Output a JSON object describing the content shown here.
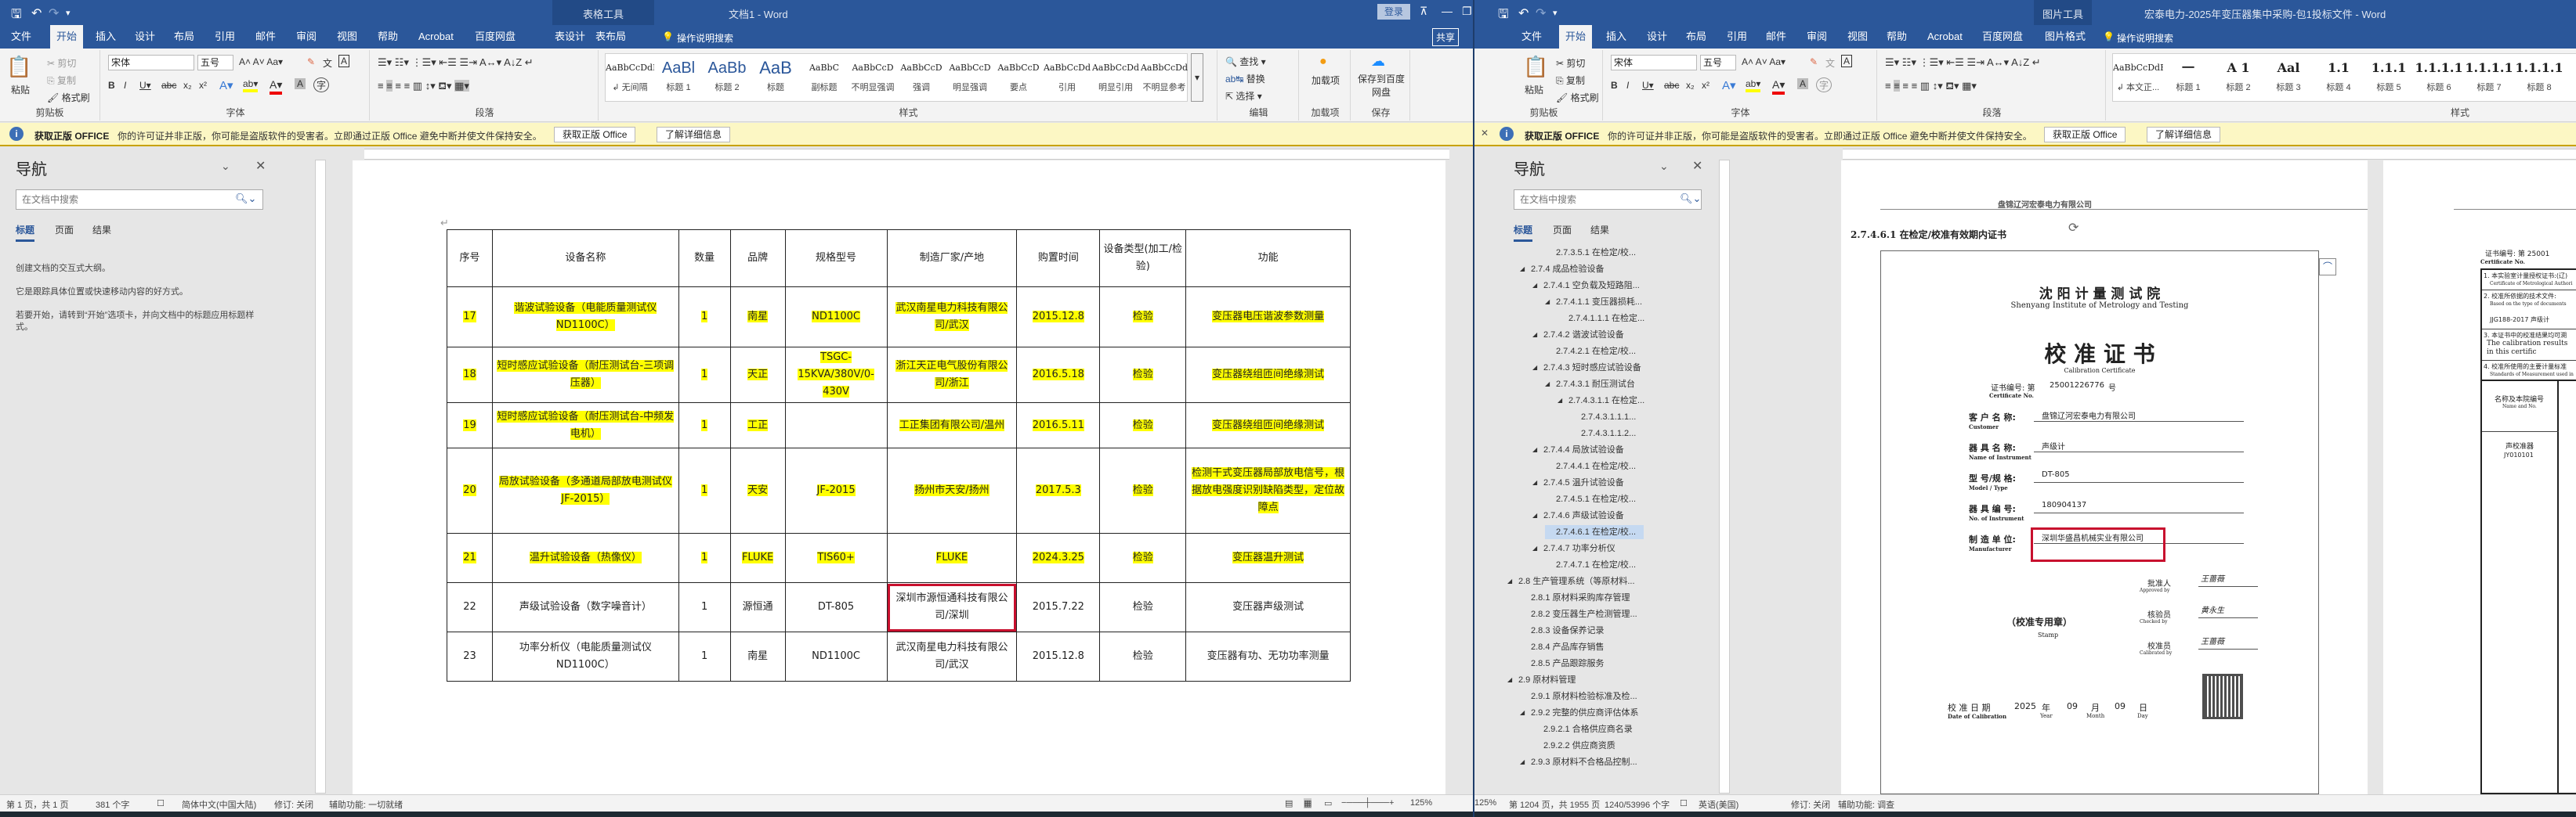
{
  "left": {
    "title": "文档1  -  Word",
    "context_group": "表格工具",
    "login": "登录",
    "share": "共享",
    "tabs": [
      "文件",
      "开始",
      "插入",
      "设计",
      "布局",
      "引用",
      "邮件",
      "审阅",
      "视图",
      "帮助",
      "Acrobat",
      "百度网盘",
      "表设计",
      "表布局"
    ],
    "tell_me": "操作说明搜索",
    "ribbon": {
      "paste": "粘贴",
      "cut": "剪切",
      "copy": "复制",
      "format_painter": "格式刷",
      "font_name": "宋体",
      "font_size": "五号",
      "group_clipboard": "剪贴板",
      "group_font": "字体",
      "group_paragraph": "段落",
      "group_styles": "样式",
      "group_editing": "编辑",
      "group_addins": "加载项",
      "group_save": "保存",
      "find": "查找",
      "replace": "替换",
      "select": "选择",
      "addins": "加载项",
      "save_baidu": "保存到百度网盘",
      "styles": [
        {
          "preview": "AaBbCcDdE",
          "name": "↲ 无间隔"
        },
        {
          "preview": "AaBl",
          "name": "标题 1"
        },
        {
          "preview": "AaBb",
          "name": "标题 2"
        },
        {
          "preview": "AaB",
          "name": "标题"
        },
        {
          "preview": "AaBbC",
          "name": "副标题"
        },
        {
          "preview": "AaBbCcD",
          "name": "不明显强调"
        },
        {
          "preview": "AaBbCcD",
          "name": "强调"
        },
        {
          "preview": "AaBbCcD",
          "name": "明显强调"
        },
        {
          "preview": "AaBbCcD",
          "name": "要点"
        },
        {
          "preview": "AaBbCcDd",
          "name": "引用"
        },
        {
          "preview": "AaBbCcDd",
          "name": "明显引用"
        },
        {
          "preview": "AaBbCcDd",
          "name": "不明显参考"
        }
      ]
    },
    "infobar": {
      "title": "获取正版 OFFICE",
      "message": "你的许可证并非正版，你可能是盗版软件的受害者。立即通过正版 Office 避免中断并使文件保持安全。",
      "get_button": "获取正版 Office",
      "learn_button": "了解详细信息"
    },
    "nav": {
      "title": "导航",
      "search_placeholder": "在文档中搜索",
      "tabs": [
        "标题",
        "页面",
        "结果"
      ],
      "hints": [
        "创建文档的交互式大纲。",
        "它是跟踪具体位置或快速移动内容的好方式。",
        "若要开始，请转到“开始”选项卡，并向文档中的标题应用标题样式。"
      ]
    },
    "table": {
      "headers": [
        "序号",
        "设备名称",
        "数量",
        "品牌",
        "规格型号",
        "制造厂家/产地",
        "购置时间",
        "设备类型(加工/检验)",
        "功能"
      ],
      "rows": [
        {
          "highlight": true,
          "cells": [
            "17",
            "谐波试验设备（电能质量测试仪ND1100C）",
            "1",
            "南星",
            "ND1100C",
            "武汉南星电力科技有限公司/武汉",
            "2015.12.8",
            "检验",
            "变压器电压谐波参数测量"
          ]
        },
        {
          "highlight": true,
          "cells": [
            "18",
            "短时感应试验设备（耐压测试台-三项调压器）",
            "1",
            "天正",
            "TSGC-15KVA/380V/0-430V",
            "浙江天正电气股份有限公司/浙江",
            "2016.5.18",
            "检验",
            "变压器绕组匝间绝缘测试"
          ]
        },
        {
          "highlight": true,
          "cells": [
            "19",
            "短时感应试验设备（耐压测试台-中频发电机）",
            "1",
            "工正",
            "",
            "工正集团有限公司/温州",
            "2016.5.11",
            "检验",
            "变压器绕组匝间绝缘测试"
          ]
        },
        {
          "highlight": true,
          "cells": [
            "20",
            "局放试验设备（多通道局部放电测试仪JF-2015）",
            "1",
            "天安",
            "JF-2015",
            "扬州市天安/扬州",
            "2017.5.3",
            "检验",
            "检测干式变压器局部放电信号，根据放电强度识别缺陷类型，定位故障点"
          ]
        },
        {
          "highlight": true,
          "cells": [
            "21",
            "温升试验设备（热像仪）",
            "1",
            "FLUKE",
            "TIS60+",
            "FLUKE",
            "2024.3.25",
            "检验",
            "变压器温升测试"
          ]
        },
        {
          "highlight": false,
          "boxed_col": 5,
          "cells": [
            "22",
            "声级试验设备（数字噪音计）",
            "1",
            "源恒通",
            "DT-805",
            "深圳市源恒通科技有限公司/深圳",
            "2015.7.22",
            "检验",
            "变压器声级测试"
          ]
        },
        {
          "highlight": false,
          "cells": [
            "23",
            "功率分析仪（电能质量测试仪ND1100C）",
            "1",
            "南星",
            "ND1100C",
            "武汉南星电力科技有限公司/武汉",
            "2015.12.8",
            "检验",
            "变压器有功、无功功率测量"
          ]
        }
      ]
    },
    "status": {
      "page": "第 1 页，共 1 页",
      "words": "381 个字",
      "language": "简体中文(中国大陆)",
      "track": "修订: 关闭",
      "accessibility": "辅助功能: 一切就绪",
      "zoom": "125%"
    }
  },
  "right": {
    "title": "宏泰电力-2025年变压器集中采购-包1投标文件  -  Word",
    "context_group": "图片工具",
    "tabs": [
      "文件",
      "开始",
      "插入",
      "设计",
      "布局",
      "引用",
      "邮件",
      "审阅",
      "视图",
      "帮助",
      "Acrobat",
      "百度网盘",
      "图片格式"
    ],
    "tell_me": "操作说明搜索",
    "ribbon": {
      "paste": "粘贴",
      "cut": "剪切",
      "copy": "复制",
      "format_painter": "格式刷",
      "font_name": "宋体",
      "font_size": "五号",
      "group_clipboard": "剪贴板",
      "group_font": "字体",
      "group_paragraph": "段落",
      "group_styles": "样式",
      "styles": [
        {
          "preview": "AaBbCcDdE",
          "name": "↲ 本文正..."
        },
        {
          "preview": "一",
          "name": "标题 1"
        },
        {
          "preview": "A 1",
          "name": "标题 2"
        },
        {
          "preview": "Aal",
          "name": "标题 3"
        },
        {
          "preview": "1.1",
          "name": "标题 4"
        },
        {
          "preview": "1.1.1",
          "name": "标题 5"
        },
        {
          "preview": "1.1.1.1",
          "name": "标题 6"
        },
        {
          "preview": "1.1.1.1",
          "name": "标题 7"
        },
        {
          "preview": "1.1.1.1",
          "name": "标题 8"
        }
      ]
    },
    "infobar": {
      "title": "获取正版 OFFICE",
      "message": "你的许可证并非正版，你可能是盗版软件的受害者。立即通过正版 Office 避免中断并使文件保持安全。",
      "get_button": "获取正版 Office",
      "learn_button": "了解详细信息"
    },
    "nav": {
      "title": "导航",
      "search_placeholder": "在文档中搜索",
      "tabs": [
        "标题",
        "页面",
        "结果"
      ],
      "items": [
        {
          "text": "2.7.3.5.1 在检定/校...",
          "level": 4,
          "arrow": false
        },
        {
          "text": "2.7.4 成品检验设备",
          "level": 2,
          "arrow": true
        },
        {
          "text": "2.7.4.1 空负载及短路阻...",
          "level": 3,
          "arrow": true
        },
        {
          "text": "2.7.4.1.1 变压器损耗...",
          "level": 4,
          "arrow": true
        },
        {
          "text": "2.7.4.1.1.1 在检定...",
          "level": 5,
          "arrow": false
        },
        {
          "text": "2.7.4.2 谐波试验设备",
          "level": 3,
          "arrow": true
        },
        {
          "text": "2.7.4.2.1 在检定/校...",
          "level": 4,
          "arrow": false
        },
        {
          "text": "2.7.4.3 短时感应试验设备",
          "level": 3,
          "arrow": true
        },
        {
          "text": "2.7.4.3.1 耐压测试台",
          "level": 4,
          "arrow": true
        },
        {
          "text": "2.7.4.3.1.1 在检定...",
          "level": 5,
          "arrow": true
        },
        {
          "text": "2.7.4.3.1.1.1...",
          "level": 6,
          "arrow": false
        },
        {
          "text": "2.7.4.3.1.1.2...",
          "level": 6,
          "arrow": false
        },
        {
          "text": "2.7.4.4 局放试验设备",
          "level": 3,
          "arrow": true
        },
        {
          "text": "2.7.4.4.1 在检定/校...",
          "level": 4,
          "arrow": false
        },
        {
          "text": "2.7.4.5 温升试验设备",
          "level": 3,
          "arrow": true
        },
        {
          "text": "2.7.4.5.1 在检定/校...",
          "level": 4,
          "arrow": false
        },
        {
          "text": "2.7.4.6 声级试验设备",
          "level": 3,
          "arrow": true
        },
        {
          "text": "2.7.4.6.1 在检定/校...",
          "level": 4,
          "arrow": false,
          "selected": true
        },
        {
          "text": "2.7.4.7 功率分析仪",
          "level": 3,
          "arrow": true
        },
        {
          "text": "2.7.4.7.1 在检定/校...",
          "level": 4,
          "arrow": false
        },
        {
          "text": "2.8 生产管理系统（等原材料...",
          "level": 1,
          "arrow": true
        },
        {
          "text": "2.8.1 原材料采购库存管理",
          "level": 2,
          "arrow": false
        },
        {
          "text": "2.8.2 变压器生产检测管理...",
          "level": 2,
          "arrow": false
        },
        {
          "text": "2.8.3 设备保养记录",
          "level": 2,
          "arrow": false
        },
        {
          "text": "2.8.4 产品库存销售",
          "level": 2,
          "arrow": false
        },
        {
          "text": "2.8.5 产品跟踪服务",
          "level": 2,
          "arrow": false
        },
        {
          "text": "2.9 原材料管理",
          "level": 1,
          "arrow": true
        },
        {
          "text": "2.9.1 原材料检验标准及检...",
          "level": 2,
          "arrow": false
        },
        {
          "text": "2.9.2 完整的供应商评估体系",
          "level": 2,
          "arrow": true
        },
        {
          "text": "2.9.2.1 合格供应商名录",
          "level": 3,
          "arrow": false
        },
        {
          "text": "2.9.2.2 供应商资质",
          "level": 3,
          "arrow": false
        },
        {
          "text": "2.9.3 原材料不合格品控制...",
          "level": 2,
          "arrow": true
        }
      ]
    },
    "doc": {
      "header": "盘锦辽河宏泰电力有限公司",
      "heading": "2.7.4.6.1 在检定/校准有效期内证书",
      "cert": {
        "institute_cn": "沈 阳 计 量 测 试 院",
        "institute_en": "Shenyang   Institute   of   Metrology   and   Testing",
        "title_cn": "校 准 证 书",
        "title_en": "Calibration   Certificate",
        "no_label": "证书编号:   第",
        "no_value": "25001226776",
        "no_suffix": "号",
        "no_label_en": "Certificate No.",
        "fields": [
          {
            "label": "客 户 名 称:",
            "label_en": "Customer",
            "value": "盘锦辽河宏泰电力有限公司"
          },
          {
            "label": "器 具 名 称:",
            "label_en": "Name of Instrument",
            "value": "声级计"
          },
          {
            "label": "型 号/规 格:",
            "label_en": "Model / Type",
            "value": "DT-805"
          },
          {
            "label": "器 具 编 号:",
            "label_en": "No. of Instrument",
            "value": "180904137"
          },
          {
            "label": "制 造 单 位:",
            "label_en": "Manufacturer",
            "value": "深圳华盛昌机械实业有限公司"
          }
        ],
        "signers": [
          {
            "label": "批准人",
            "label_en": "Approved by",
            "signature": "王蔷薇"
          },
          {
            "label": "核验员",
            "label_en": "Checked by",
            "signature": "黄永生"
          },
          {
            "label": "校准员",
            "label_en": "Calibrated by",
            "signature": "王蔷薇"
          }
        ],
        "stamp": "（校准专用章）",
        "stamp_en": "Stamp",
        "date_label": "校 准 日 期",
        "date_label_en": "Date of Calibration",
        "year": "2025",
        "year_cn": "年",
        "year_en": "Year",
        "month": "09",
        "month_cn": "月",
        "month_en": "Month",
        "day": "09",
        "day_cn": "日",
        "day_en": "Day"
      },
      "page2": {
        "no_label": "证书编号:   第   25001",
        "no_label_en": "Certificate No.",
        "items": [
          {
            "cn": "1. 本实验室计量授权证书:(辽)",
            "en": "Certificate of Metrological Authori"
          },
          {
            "cn": "2. 校准所依据的技术文件:",
            "en": "Based on the type of documents",
            "extra": "JJG188-2017 声级计"
          },
          {
            "cn": "3. 本证书中的校准结果均可溯",
            "en": "The calibration results in this certific"
          },
          {
            "cn": "4. 校准所使用的主要计量标准",
            "en": "Standards of Measurement used in"
          }
        ],
        "col_header": "名称及本院编号",
        "col_header_en": "Name and No.",
        "std_name": "声校准器",
        "std_no": "JY010101"
      }
    },
    "status": {
      "zoom": "125%",
      "page": "第 1204 页，共 1955 页",
      "words": "1240/53996 个字",
      "language": "英语(美国)",
      "track": "修订: 关闭",
      "accessibility": "辅助功能: 调查"
    }
  }
}
